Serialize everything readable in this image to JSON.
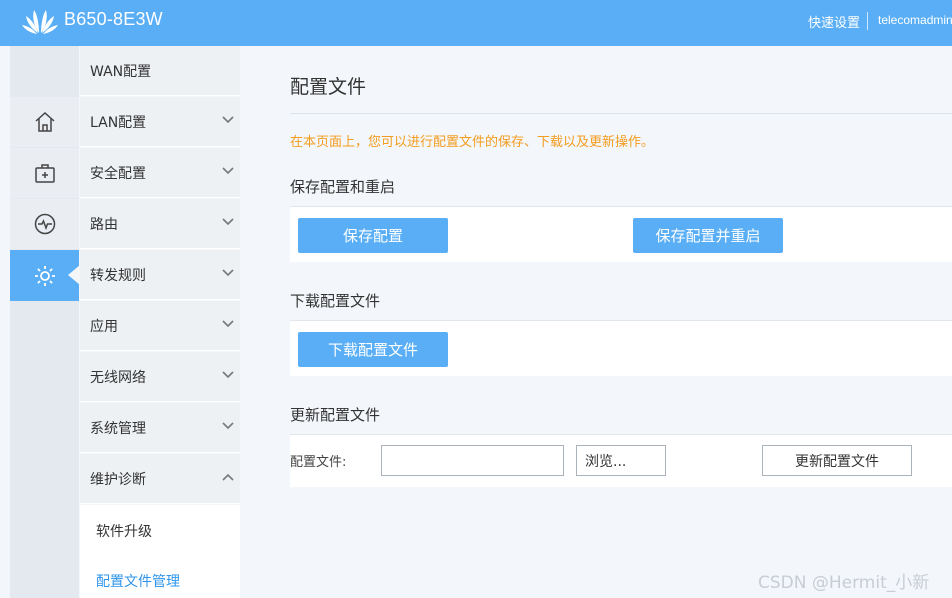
{
  "header": {
    "model": "B650-8E3W",
    "quick_setup": "快速设置",
    "user": "telecomadmin",
    "bg_color": "#59aef6"
  },
  "icon_rail": [
    {
      "icon": "home-icon"
    },
    {
      "icon": "medical-box-icon"
    },
    {
      "icon": "pulse-icon"
    },
    {
      "icon": "gear-icon",
      "active": true
    }
  ],
  "menu": {
    "items": [
      {
        "label": "WAN配置",
        "expandable": false
      },
      {
        "label": "LAN配置",
        "expandable": true,
        "expanded": false
      },
      {
        "label": "安全配置",
        "expandable": true,
        "expanded": false
      },
      {
        "label": "路由",
        "expandable": true,
        "expanded": false
      },
      {
        "label": "转发规则",
        "expandable": true,
        "expanded": false
      },
      {
        "label": "应用",
        "expandable": true,
        "expanded": false
      },
      {
        "label": "无线网络",
        "expandable": true,
        "expanded": false
      },
      {
        "label": "系统管理",
        "expandable": true,
        "expanded": false
      },
      {
        "label": "维护诊断",
        "expandable": true,
        "expanded": true
      }
    ],
    "subitems": [
      {
        "label": "软件升级",
        "active": false
      },
      {
        "label": "配置文件管理",
        "active": true
      }
    ]
  },
  "main": {
    "title": "配置文件",
    "hint": "在本页面上，您可以进行配置文件的保存、下载以及更新操作。",
    "save_section": {
      "title": "保存配置和重启",
      "save_button": "保存配置",
      "save_reboot_button": "保存配置并重启"
    },
    "download_section": {
      "title": "下载配置文件",
      "download_button": "下载配置文件"
    },
    "update_section": {
      "title": "更新配置文件",
      "file_label": "配置文件:",
      "file_value": "",
      "browse_button": "浏览...",
      "update_button": "更新配置文件"
    }
  },
  "watermark": "CSDN @Hermit_小新",
  "colors": {
    "accent": "#59aef6",
    "hint": "#f39c1f",
    "active_text": "#2f95eb"
  }
}
